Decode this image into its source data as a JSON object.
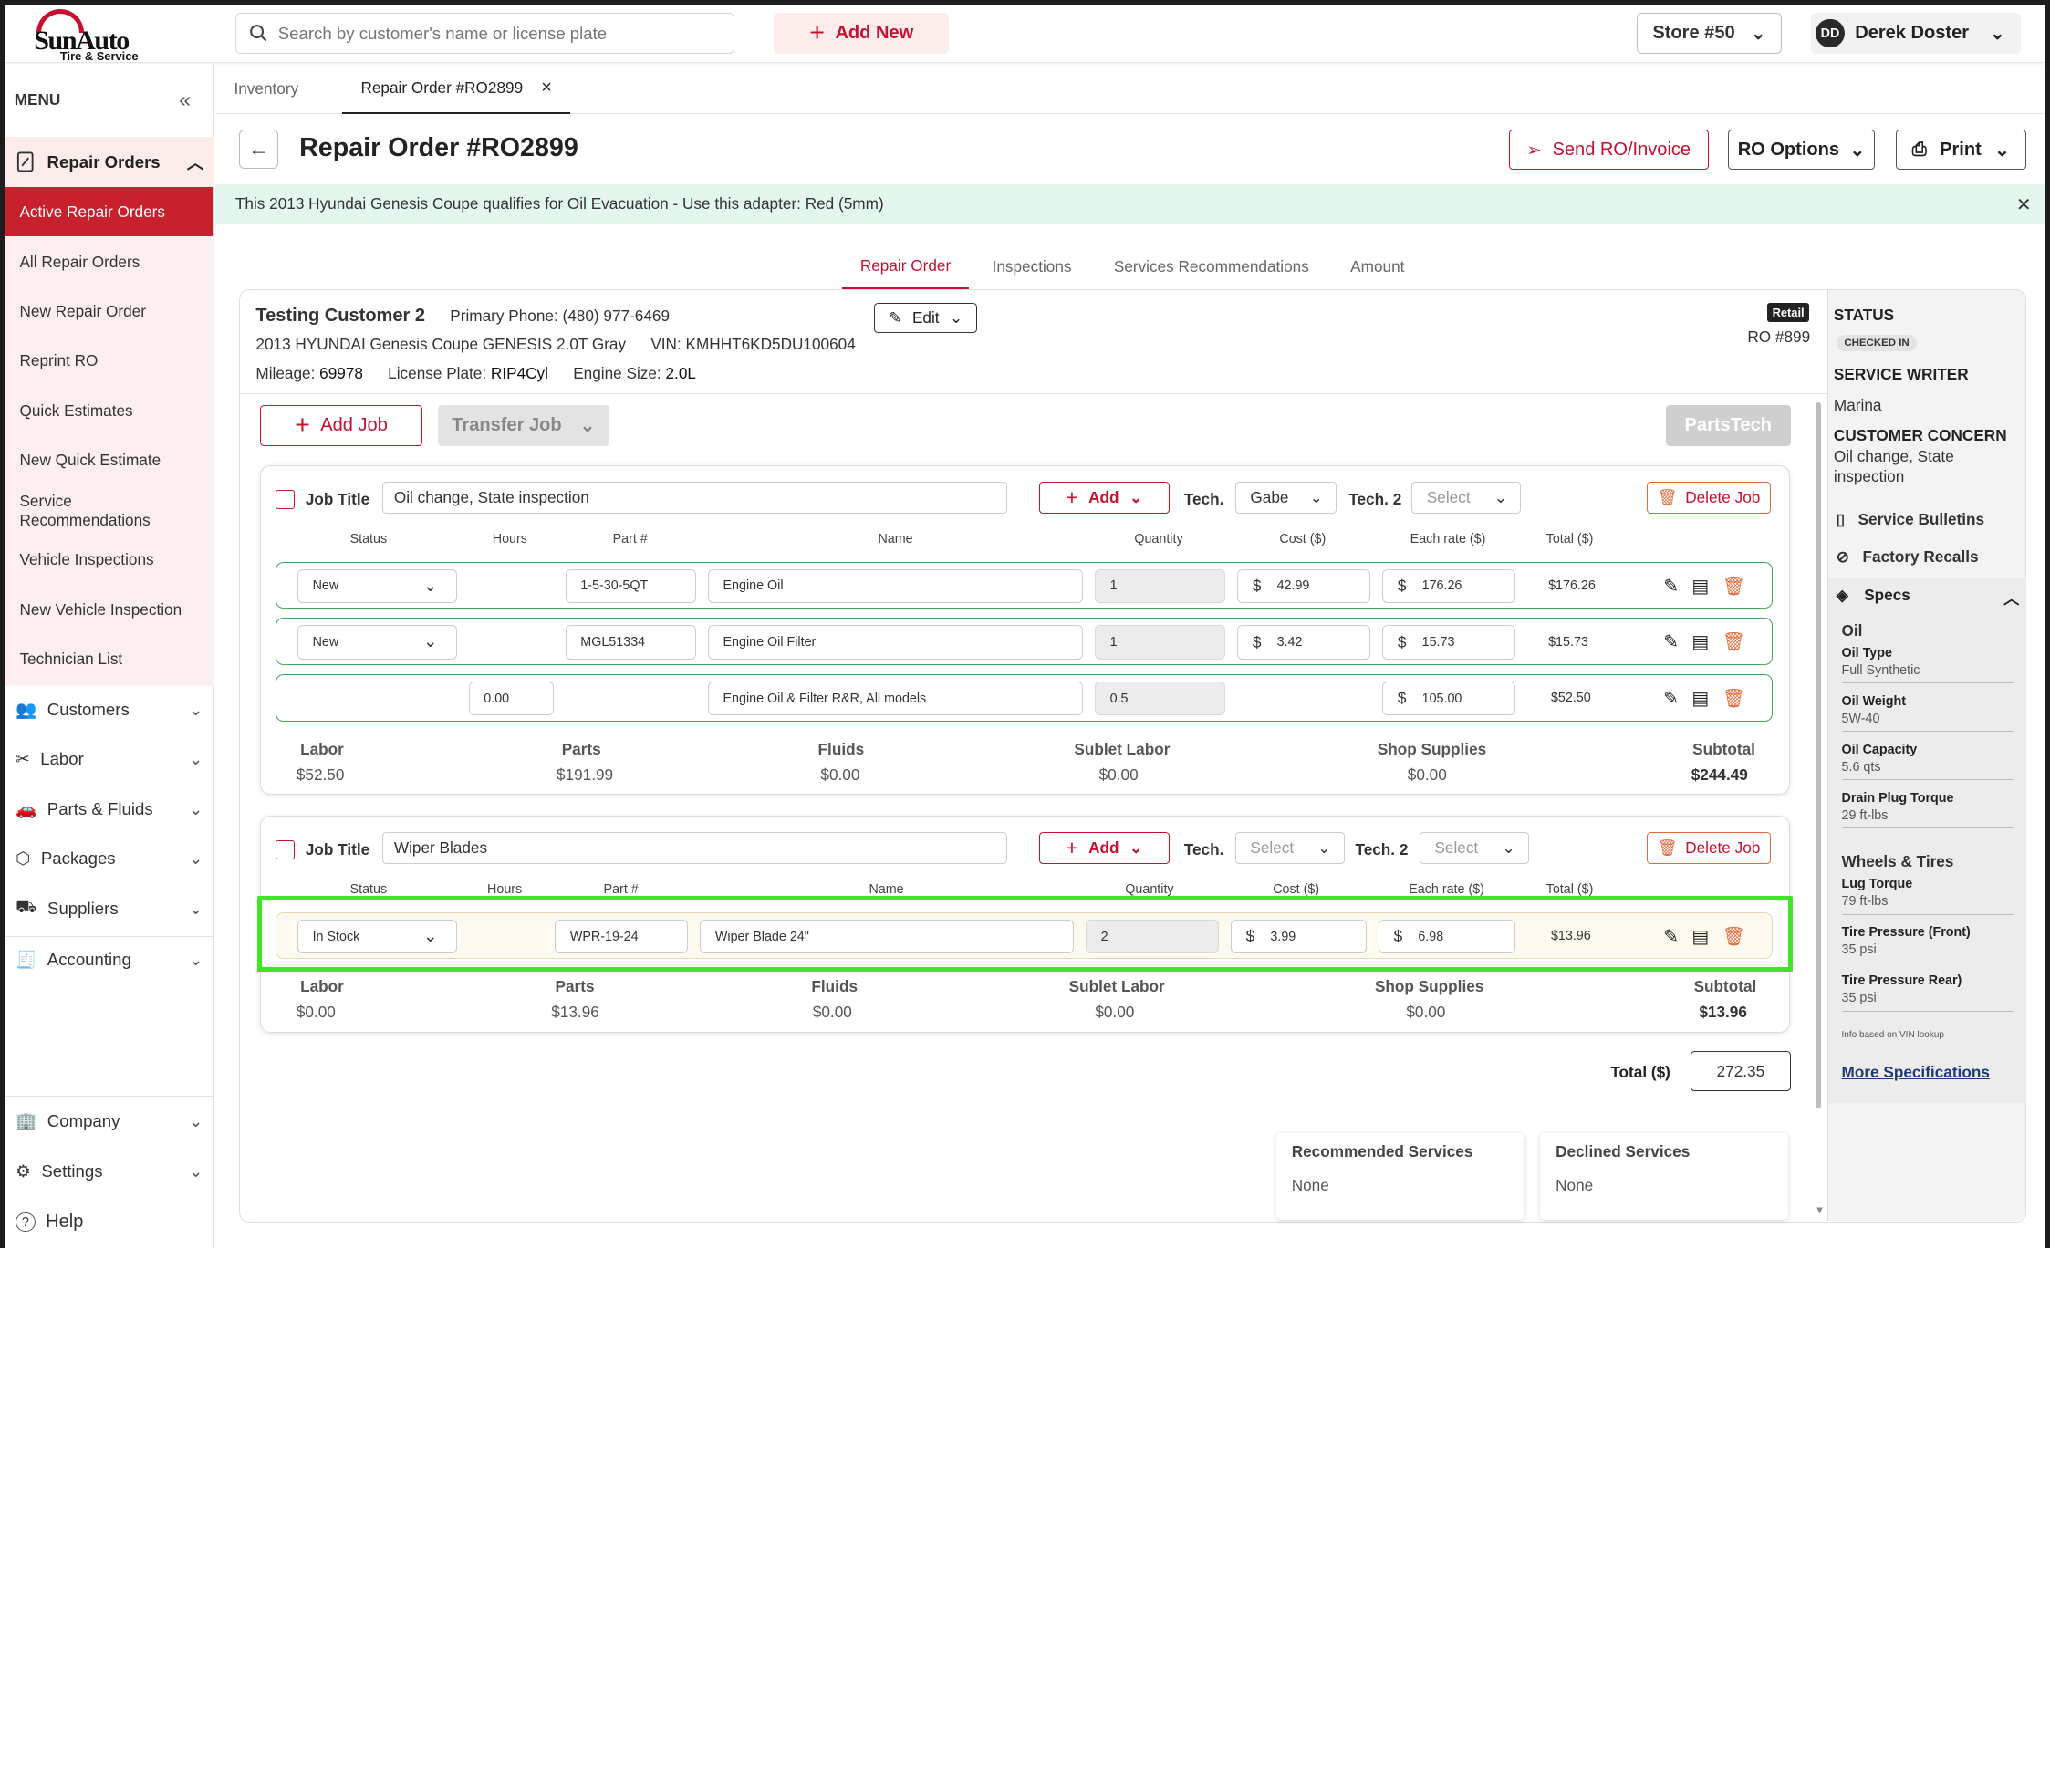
{
  "brand": {
    "name": "SunAuto",
    "tagline": "Tire & Service"
  },
  "search": {
    "placeholder": "Search by customer's name or license plate"
  },
  "header": {
    "add_new": "Add New",
    "store": "Store #50",
    "user_initials": "DD",
    "user_name": "Derek Doster"
  },
  "sidebar": {
    "menu": "MENU",
    "repair_orders": "Repair Orders",
    "sub": [
      "Active Repair Orders",
      "All Repair Orders",
      "New Repair Order",
      "Reprint RO",
      "Quick Estimates",
      "New Quick Estimate",
      "Service Recommendations",
      "Vehicle Inspections",
      "New Vehicle Inspection",
      "Technician List"
    ],
    "items": [
      "Customers",
      "Labor",
      "Parts & Fluids",
      "Packages",
      "Suppliers",
      "Accounting"
    ],
    "bottom": [
      "Company",
      "Settings",
      "Help"
    ]
  },
  "tabs": [
    "Inventory",
    "Repair Order #RO2899"
  ],
  "page": {
    "title": "Repair Order #RO2899",
    "send": "Send RO/Invoice",
    "options": "RO Options",
    "print": "Print"
  },
  "banner": "This 2013 Hyundai Genesis Coupe qualifies for Oil Evacuation - Use this adapter: Red (5mm)",
  "inner_tabs": [
    "Repair Order",
    "Inspections",
    "Services Recommendations",
    "Amount"
  ],
  "customer": {
    "name": "Testing Customer 2",
    "phone": "Primary Phone: (480) 977-6469",
    "vehicle": "2013 HYUNDAI Genesis Coupe GENESIS 2.0T Gray",
    "vin": "VIN: KMHHT6KD5DU100604",
    "mileage_lbl": "Mileage:",
    "mileage": "69978",
    "plate_lbl": "License Plate:",
    "plate": "RIP4Cyl",
    "engine_lbl": "Engine Size:",
    "engine": "2.0L",
    "edit": "Edit",
    "badge": "Retail",
    "ro": "RO #899"
  },
  "actions": {
    "add_job": "Add Job",
    "transfer_job": "Transfer Job",
    "partstech": "PartsTech"
  },
  "columns": [
    "Status",
    "Hours",
    "Part #",
    "Name",
    "Quantity",
    "Cost ($)",
    "Each rate ($)",
    "Total ($)"
  ],
  "job_labels": {
    "job_title": "Job Title",
    "add": "Add",
    "tech": "Tech.",
    "tech2": "Tech. 2",
    "delete": "Delete Job"
  },
  "jobs": [
    {
      "title": "Oil change,  State inspection",
      "tech": "Gabe",
      "tech2": "Select",
      "lines": [
        {
          "status": "New",
          "part": "1-5-30-5QT",
          "name": "Engine Oil",
          "qty": "1",
          "cost": "42.99",
          "rate": "176.26",
          "total": "$176.26"
        },
        {
          "status": "New",
          "part": "MGL51334",
          "name": "Engine Oil Filter",
          "qty": "1",
          "cost": "3.42",
          "rate": "15.73",
          "total": "$15.73"
        },
        {
          "hours": "0.00",
          "name": "Engine Oil & Filter R&R, All models",
          "qty": "0.5",
          "rate": "105.00",
          "total": "$52.50"
        }
      ],
      "summary": {
        "Labor": "$52.50",
        "Parts": "$191.99",
        "Fluids": "$0.00",
        "Sublet Labor": "$0.00",
        "Shop Supplies": "$0.00",
        "Subtotal": "$244.49"
      }
    },
    {
      "title": "Wiper Blades",
      "tech": "Select",
      "tech2": "Select",
      "lines": [
        {
          "status": "In Stock",
          "part": "WPR-19-24",
          "name": "Wiper Blade 24\"",
          "qty": "2",
          "cost": "3.99",
          "rate": "6.98",
          "total": "$13.96"
        }
      ],
      "summary": {
        "Labor": "$0.00",
        "Parts": "$13.96",
        "Fluids": "$0.00",
        "Sublet Labor": "$0.00",
        "Shop Supplies": "$0.00",
        "Subtotal": "$13.96"
      }
    }
  ],
  "summary_keys": [
    "Labor",
    "Parts",
    "Fluids",
    "Sublet Labor",
    "Shop Supplies",
    "Subtotal"
  ],
  "total": {
    "label": "Total ($)",
    "value": "272.35"
  },
  "recommended": {
    "title": "Recommended Services",
    "value": "None"
  },
  "declined": {
    "title": "Declined Services",
    "value": "None"
  },
  "status_panel": {
    "status": "STATUS",
    "chip": "CHECKED IN",
    "writer_lbl": "SERVICE WRITER",
    "writer": "Marina",
    "concern_lbl": "CUSTOMER CONCERN",
    "concern": "Oil change, State inspection",
    "bulletins": "Service Bulletins",
    "recalls": "Factory Recalls",
    "specs": "Specs",
    "oil": "Oil",
    "oil_specs": [
      {
        "k": "Oil Type",
        "v": "Full Synthetic"
      },
      {
        "k": "Oil Weight",
        "v": "5W-40"
      },
      {
        "k": "Oil Capacity",
        "v": "5.6 qts"
      },
      {
        "k": "Drain Plug Torque",
        "v": "29 ft-lbs"
      }
    ],
    "wheels": "Wheels & Tires",
    "wheel_specs": [
      {
        "k": "Lug Torque",
        "v": "79 ft-lbs"
      },
      {
        "k": "Tire Pressure (Front)",
        "v": "35 psi"
      },
      {
        "k": "Tire Pressure Rear)",
        "v": "35 psi"
      }
    ],
    "vin_note": "Info based on VIN lookup",
    "more": "More Specifications"
  }
}
